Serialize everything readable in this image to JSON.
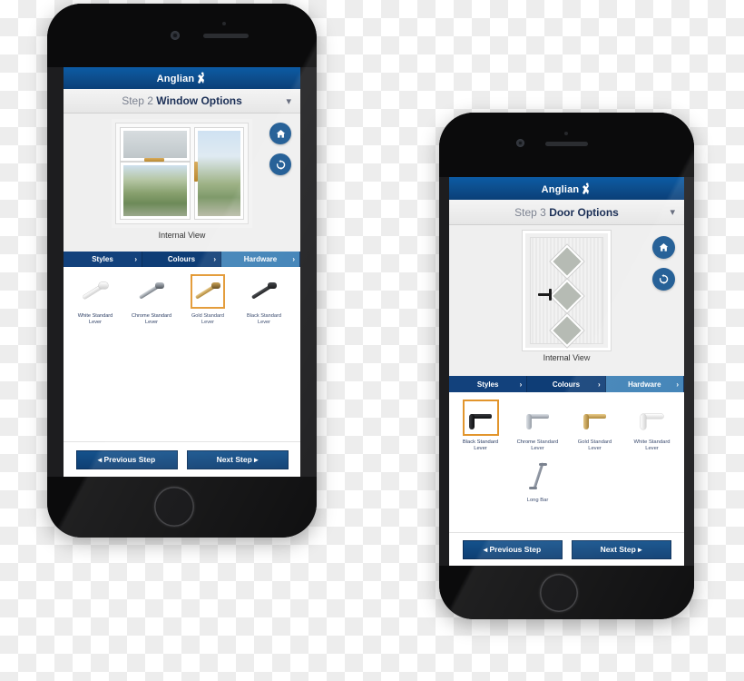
{
  "phone1": {
    "app": {
      "logo_text": "Anglian",
      "logo_icon": "horse-rider-icon"
    },
    "step": {
      "number": "Step 2",
      "title": "Window Options",
      "chevron": "chevron-down-icon"
    },
    "preview": {
      "caption": "Internal View",
      "product": "white-double-window",
      "actions": [
        {
          "name": "home-button",
          "icon": "home-icon"
        },
        {
          "name": "reset-button",
          "icon": "refresh-icon"
        }
      ]
    },
    "tabs": [
      {
        "label": "Styles",
        "active": false,
        "arrow": "›"
      },
      {
        "label": "Colours",
        "active": false,
        "arrow": "›"
      },
      {
        "label": "Hardware",
        "active": true,
        "arrow": "›"
      }
    ],
    "hardware": [
      {
        "name": "White Standard",
        "sub": "Lever",
        "color": "#e9e9e9",
        "selected": false
      },
      {
        "name": "Chrome Standard",
        "sub": "Lever",
        "color": "#9aa0a8",
        "selected": false
      },
      {
        "name": "Gold Standard",
        "sub": "Lever",
        "color": "#c09038",
        "selected": true
      },
      {
        "name": "Black Standard",
        "sub": "Lever",
        "color": "#17181a",
        "selected": false
      }
    ],
    "nav": {
      "previous": "Previous Step",
      "next": "Next Step",
      "prev_arrow": "◂",
      "next_arrow": "▸"
    }
  },
  "phone2": {
    "app": {
      "logo_text": "Anglian",
      "logo_icon": "horse-rider-icon"
    },
    "step": {
      "number": "Step 3",
      "title": "Door Options",
      "chevron": "chevron-down-icon"
    },
    "preview": {
      "caption": "Internal View",
      "product": "white-diamond-panel-door",
      "actions": [
        {
          "name": "home-button",
          "icon": "home-icon"
        },
        {
          "name": "reset-button",
          "icon": "refresh-icon"
        }
      ]
    },
    "tabs": [
      {
        "label": "Styles",
        "active": false,
        "arrow": "›"
      },
      {
        "label": "Colours",
        "active": false,
        "arrow": "›"
      },
      {
        "label": "Hardware",
        "active": true,
        "arrow": "›"
      }
    ],
    "hardware": [
      {
        "name": "Black Standard",
        "sub": "Lever",
        "color": "#17181a",
        "selected": true
      },
      {
        "name": "Chrome Standard",
        "sub": "Lever",
        "color": "#a2a8b0",
        "selected": false
      },
      {
        "name": "Gold Standard",
        "sub": "Lever",
        "color": "#c49a44",
        "selected": false
      },
      {
        "name": "White Standard",
        "sub": "Lever",
        "color": "#ececec",
        "selected": false
      },
      {
        "name": "Long Bar",
        "sub": "",
        "color": "#7d848f",
        "selected": false
      }
    ],
    "nav": {
      "previous": "Previous Step",
      "next": "Next Step",
      "prev_arrow": "◂",
      "next_arrow": "▸"
    }
  },
  "colors": {
    "brand_blue": "#0d4f8f",
    "tab_active": "#3b7fb5",
    "selection_gold": "#e2952c",
    "label_navy": "#2b3d63"
  }
}
